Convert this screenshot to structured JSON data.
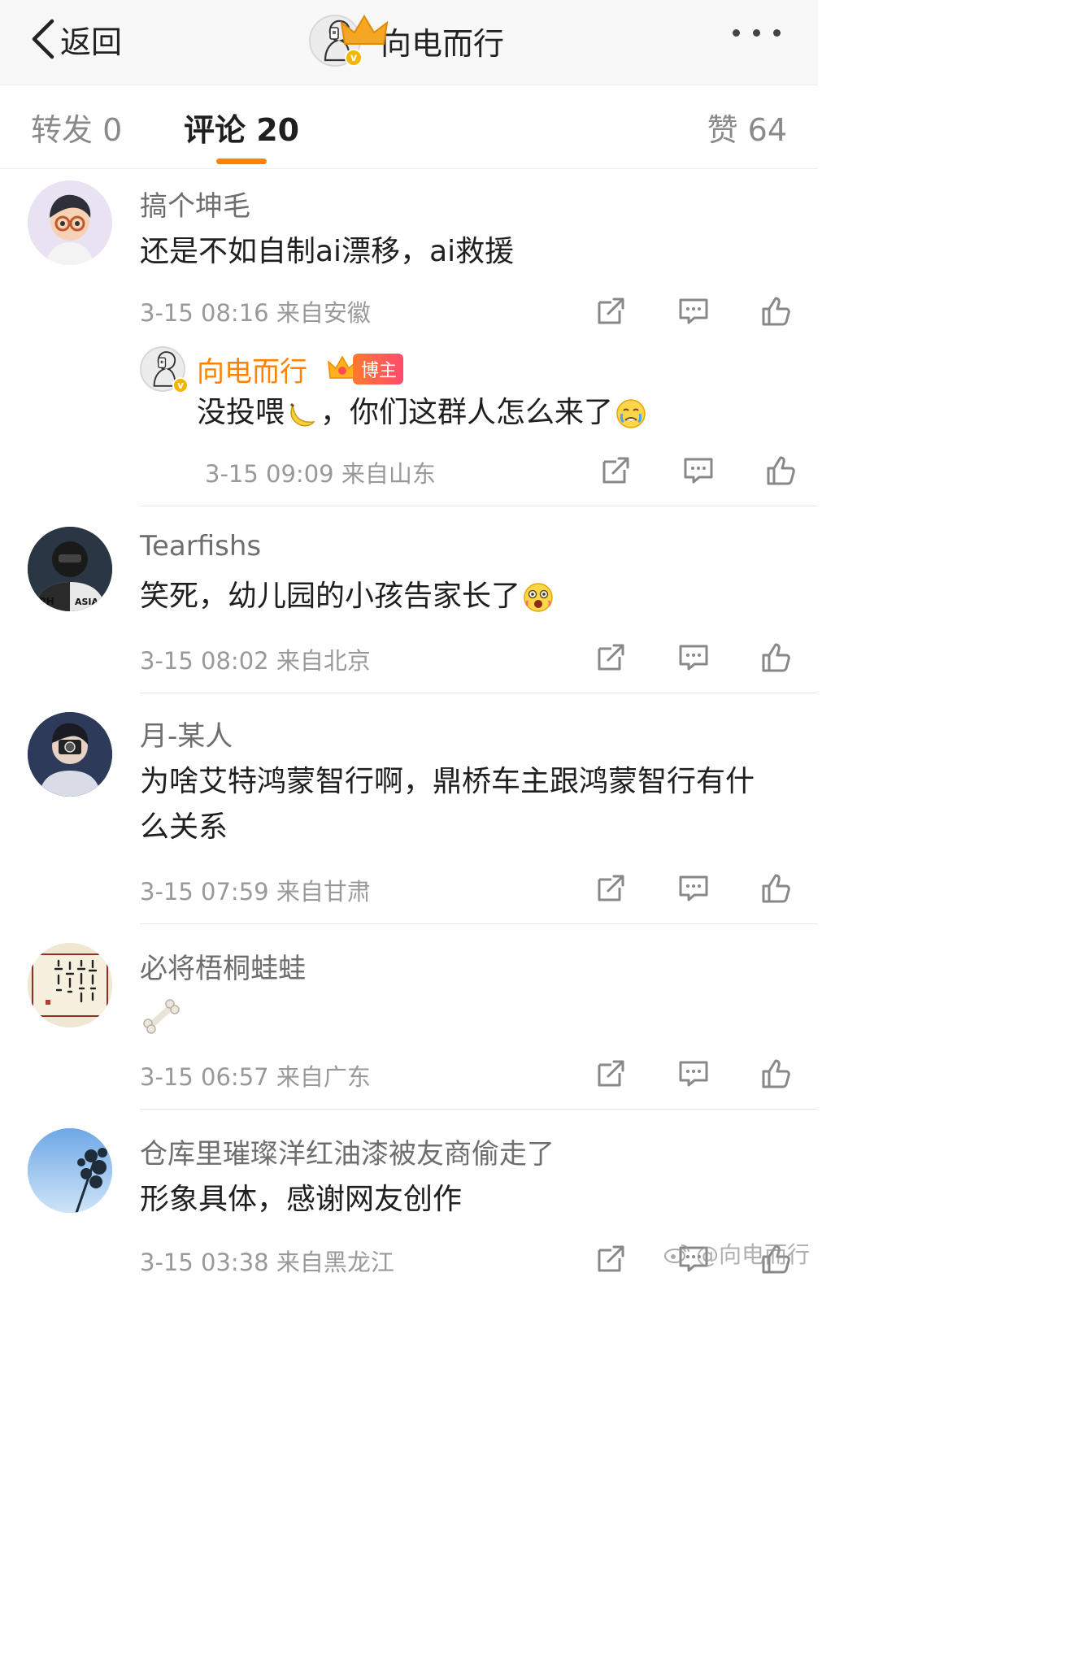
{
  "header": {
    "back_label": "返回",
    "account_name": "向电而行",
    "more_label": "•••"
  },
  "tabs": {
    "repost": "转发 0",
    "comment": "评论 20",
    "like": "赞 64"
  },
  "comments": [
    {
      "name": "搞个坤毛",
      "text": "还是不如自制ai漂移，ai救援",
      "meta": "3-15 08:16 来自安徽",
      "reply": {
        "name": "向电而行",
        "badge": "博主",
        "text_before": "没投喂",
        "text_mid": "，你们这群人怎么来了",
        "meta": "3-15 09:09 来自山东"
      }
    },
    {
      "name": "Tearfishs",
      "text": "笑死，幼儿园的小孩告家长了",
      "meta": "3-15 08:02 来自北京"
    },
    {
      "name": "月-某人",
      "text": "为啥艾特鸿蒙智行啊，鼎桥车主跟鸿蒙智行有什么关系",
      "meta": "3-15 07:59 来自甘肃"
    },
    {
      "name": "必将梧桐蛙蛙",
      "text": "",
      "meta": "3-15 06:57 来自广东"
    },
    {
      "name": "仓库里璀璨洋红油漆被友商偷走了",
      "text": "形象具体，感谢网友创作",
      "meta": "3-15 03:38 来自黑龙江"
    }
  ],
  "watermark": "@向电而行",
  "colors": {
    "accent": "#ff8200",
    "meta": "#999999",
    "text": "#1f1f1f"
  },
  "icons": [
    "chevron-left-icon",
    "more-icon",
    "share-icon",
    "comment-icon",
    "like-icon",
    "banana-emoji",
    "crying-emoji",
    "shocked-emoji",
    "bone-emoji",
    "crown-icon",
    "weibo-icon"
  ]
}
